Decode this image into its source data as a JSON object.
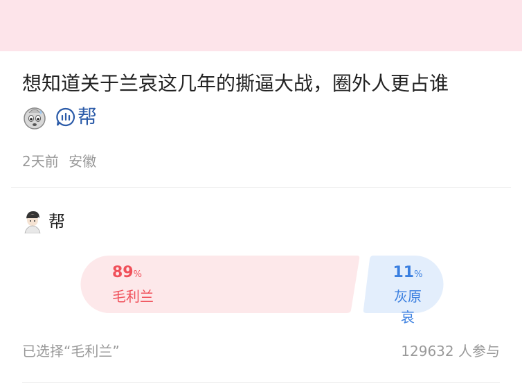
{
  "post": {
    "title": "想知道关于兰哀这几年的撕逼大战，圈外人更占谁",
    "title_tail": "帮",
    "time": "2天前",
    "location": "安徽"
  },
  "poll": {
    "question": "帮",
    "options": [
      {
        "label": "毛利兰",
        "percent": "89",
        "unit": "%",
        "share": 0.89,
        "color": "#f0505a"
      },
      {
        "label": "灰原哀",
        "percent": "11",
        "unit": "%",
        "share": 0.11,
        "color": "#3a7fe0"
      }
    ],
    "chosen_text": "已选择“毛利兰”",
    "participants": "129632 人参与"
  },
  "colors": {
    "banner": "#fde4ea",
    "left_bar": "#fde8ea",
    "right_bar": "#e3eefc"
  }
}
